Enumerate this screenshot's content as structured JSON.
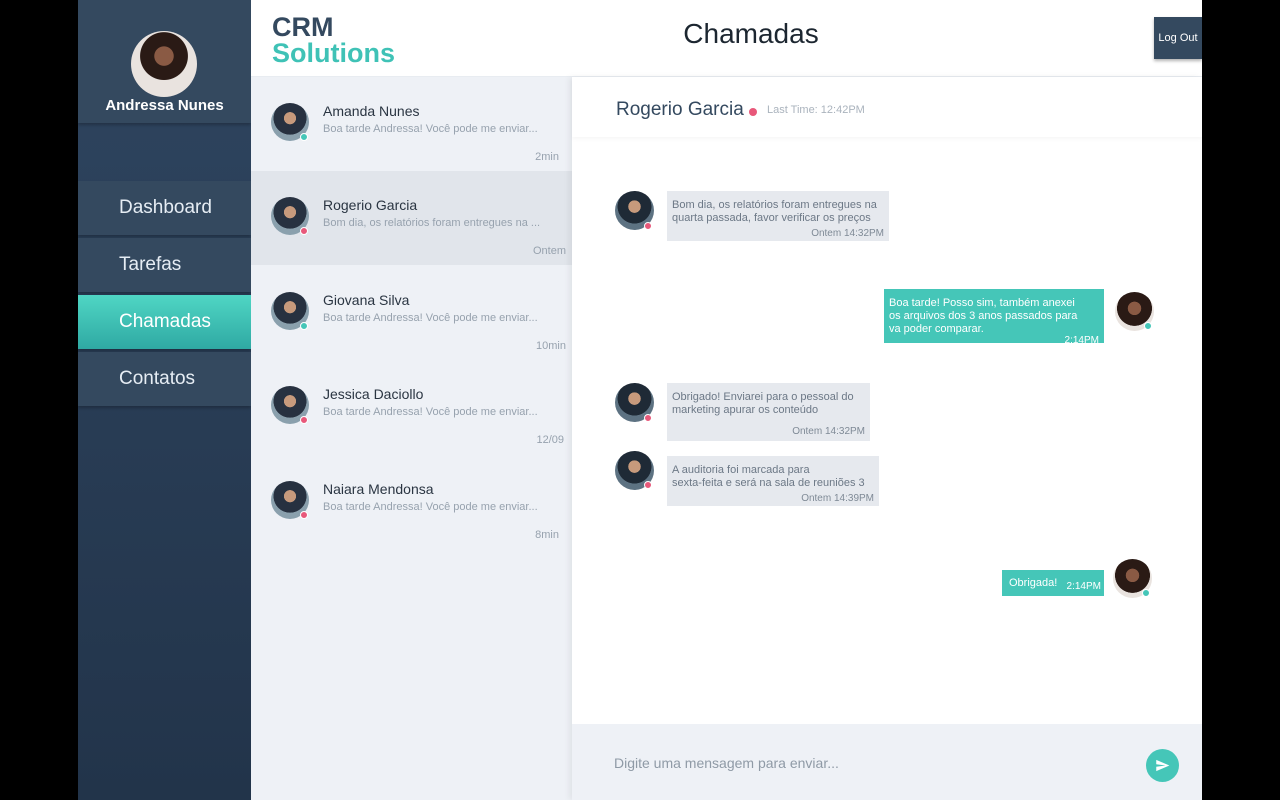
{
  "colors": {
    "accent": "#45c6b8",
    "sidebar": "#2f4560",
    "status_red": "#e8587a",
    "status_green": "#45c6b8"
  },
  "user": {
    "name": "Andressa Nunes",
    "avatar_icon": "user-avatar-icon"
  },
  "nav": [
    {
      "label": "Dashboard",
      "active": false
    },
    {
      "label": "Tarefas",
      "active": false
    },
    {
      "label": "Chamadas",
      "active": true
    },
    {
      "label": "Contatos",
      "active": false
    }
  ],
  "header": {
    "logo_line1": "CRM",
    "logo_line2": "Solutions",
    "title": "Chamadas",
    "logout_label": "Log Out"
  },
  "conversations": [
    {
      "name": "Amanda Nunes",
      "preview": "Boa tarde Andressa! Você pode me enviar...",
      "time": "2min",
      "status": "online",
      "active": false
    },
    {
      "name": "Rogerio Garcia",
      "preview": "Bom dia, os relatórios foram entregues na ...",
      "time": "Ontem",
      "status": "offline",
      "active": true
    },
    {
      "name": "Giovana Silva",
      "preview": "Boa tarde Andressa! Você pode me enviar...",
      "time": "10min",
      "status": "online",
      "active": false
    },
    {
      "name": "Jessica Daciollo",
      "preview": "Boa tarde Andressa! Você pode me enviar...",
      "time": "12/09",
      "status": "offline",
      "active": false
    },
    {
      "name": "Naiara Mendonsa",
      "preview": "Boa tarde Andressa! Você pode me enviar...",
      "time": "8min",
      "status": "offline",
      "active": false
    }
  ],
  "chat": {
    "contact_name": "Rogerio Garcia",
    "last_time": "Last Time: 12:42PM",
    "messages": [
      {
        "from": "contact",
        "lines": [
          "Bom dia, os relatórios foram entregues na",
          "quarta passada, favor verificar os preços"
        ],
        "time": "Ontem 14:32PM"
      },
      {
        "from": "me",
        "lines": [
          "Boa tarde! Posso sim, também anexei",
          "os arquivos dos 3 anos passados para",
          "va poder comparar."
        ],
        "time": "2:14PM"
      },
      {
        "from": "contact",
        "lines": [
          "Obrigado! Enviarei para o pessoal do",
          "marketing apurar os conteúdo"
        ],
        "time": "Ontem 14:32PM"
      },
      {
        "from": "contact",
        "lines": [
          "A auditoria foi marcada para",
          "sexta-feita e será na sala de reuniões 3"
        ],
        "time": "Ontem 14:39PM"
      },
      {
        "from": "me",
        "lines": [
          "Obrigada!"
        ],
        "time": "2:14PM"
      }
    ],
    "input_placeholder": "Digite uma mensagem para enviar...",
    "send_icon": "send-icon"
  }
}
